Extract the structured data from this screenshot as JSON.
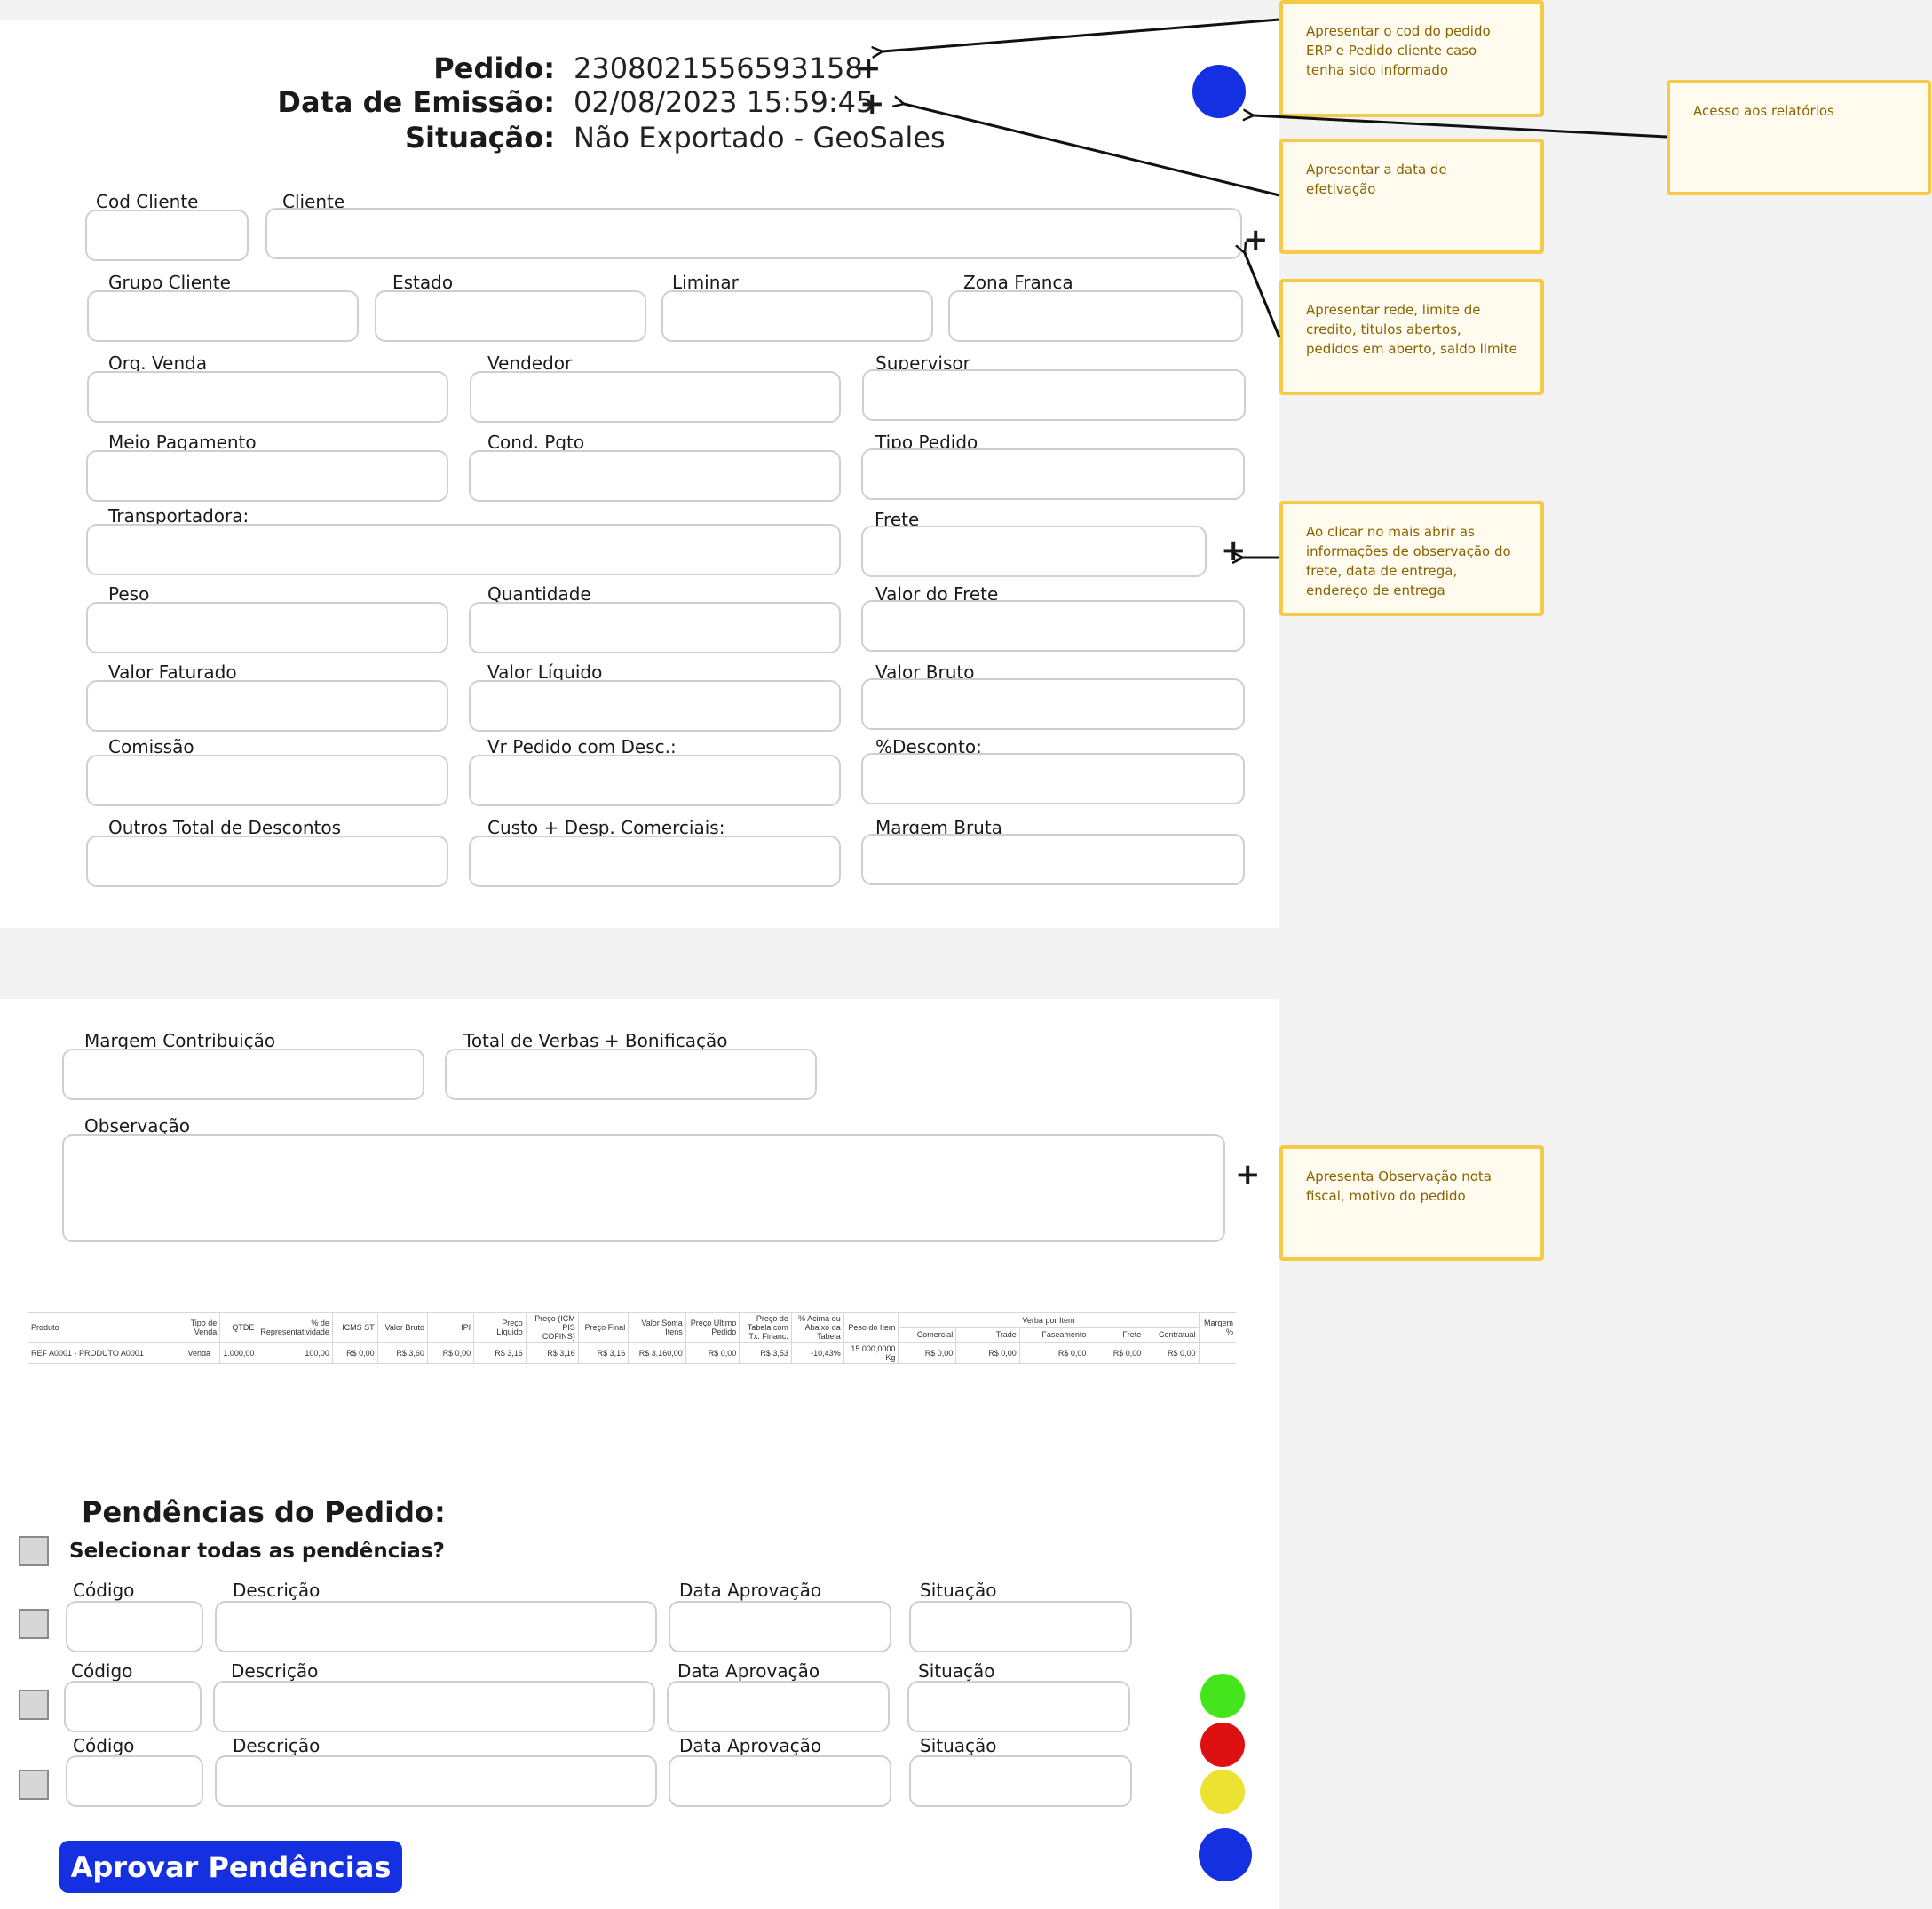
{
  "header": {
    "pedido_label": "Pedido:",
    "pedido_value": "2308021556593158",
    "emissao_label": "Data de Emissão:",
    "emissao_value": "02/08/2023 15:59:45",
    "situacao_label": "Situação:",
    "situacao_value": "Não Exportado - GeoSales"
  },
  "plus_glyph": "+",
  "fields": {
    "cod_cliente": "Cod Cliente",
    "cliente": "Cliente",
    "grupo_cliente": "Grupo Cliente",
    "estado": "Estado",
    "liminar": "Liminar",
    "zona_franca": "Zona Franca",
    "org_venda": "Org. Venda",
    "vendedor": "Vendedor",
    "supervisor": "Supervisor",
    "meio_pagamento": "Meio Pagamento",
    "cond_pgto": "Cond. Pgto",
    "tipo_pedido": "Tipo Pedido",
    "transportadora": "Transportadora:",
    "frete": "Frete",
    "peso": "Peso",
    "quantidade": "Quantidade",
    "valor_frete": "Valor do Frete",
    "valor_faturado": "Valor Faturado",
    "valor_liquido": "Valor Líquido",
    "valor_bruto": "Valor Bruto",
    "comissao": "Comissão",
    "vr_pedido_desc": "Vr Pedido com Desc.:",
    "pct_desconto": "%Desconto:",
    "outros_descontos": "Outros Total de Descontos",
    "custo_desp": "Custo + Desp. Comerciais:",
    "margem_bruta": "Margem Bruta",
    "margem_contribuicao": "Margem Contribuição",
    "total_verbas": "Total de Verbas + Bonificação",
    "observacao": "Observação"
  },
  "notes": {
    "n1": "Apresentar o cod do pedido ERP e Pedido cliente caso tenha sido informado",
    "n2": "Acesso aos relatórios",
    "n3": "Apresentar a data de efetivação",
    "n4": "Apresentar rede, limite de credito, titulos abertos, pedidos em aberto, saldo limite",
    "n5": "Ao clicar no mais abrir as informações de observação do frete, data de entrega, endereço de entrega",
    "n6": "Apresenta Observação nota fiscal, motivo do pedido"
  },
  "items_table": {
    "headers": {
      "produto": "Produto",
      "tipo_venda": "Tipo de Venda",
      "qtde": "QTDE",
      "pct_repr": "% de Representatividade",
      "icms_st": "ICMS ST",
      "valor_bruto": "Valor Bruto",
      "ipi": "IPI",
      "preco_liquido": "Preço Líquido",
      "preco_icm": "Preço (ICM PIS COFINS)",
      "preco_final": "Preço Final",
      "valor_soma": "Valor Soma Itens",
      "preco_ultimo": "Preço Último Pedido",
      "preco_tabela": "Preço de Tabela com Tx. Financ.",
      "pct_acima": "% Acima ou Abaixo da Tabela",
      "peso_item": "Peso do Item",
      "verba_group": "Verba por Item",
      "comercial": "Comercial",
      "trade": "Trade",
      "faseamento": "Faseamento",
      "frete": "Frete",
      "contratual": "Contratual",
      "margem": "Margem %"
    },
    "row": {
      "produto": "REF A0001 - PRODUTO A0001",
      "tipo_venda": "Venda",
      "qtde": "1.000,00",
      "pct_repr": "100,00",
      "icms_st": "R$ 0,00",
      "valor_bruto": "R$ 3,60",
      "ipi": "R$ 0,00",
      "preco_liquido": "R$ 3,16",
      "preco_icm": "R$ 3,16",
      "preco_final": "R$ 3,16",
      "valor_soma": "R$ 3.160,00",
      "preco_ultimo": "R$ 0,00",
      "preco_tabela": "R$ 3,53",
      "pct_acima": "-10,43%",
      "peso_item": "15.000,0000 Kg",
      "comercial": "R$ 0,00",
      "trade": "R$ 0,00",
      "faseamento": "R$ 0,00",
      "frete": "R$ 0,00",
      "contratual": "R$ 0,00",
      "margem": ""
    }
  },
  "pendencias": {
    "title": "Pendências do Pedido:",
    "select_all": "Selecionar todas as pendências?",
    "col_codigo": "Código",
    "col_descricao": "Descrição",
    "col_data": "Data Aprovação",
    "col_situacao": "Situação",
    "approve_button": "Aprovar Pendências"
  },
  "colors": {
    "accent_blue": "#1430e0",
    "status_green": "#44e51c",
    "status_red": "#dd1111",
    "status_yellow": "#ece231",
    "note_border": "#f7c948",
    "note_text": "#8a6200"
  },
  "icons": [
    "plus-icon",
    "report-access-icon",
    "status-green-icon",
    "status-red-icon",
    "status-yellow-icon",
    "status-blue-icon",
    "checkbox"
  ]
}
